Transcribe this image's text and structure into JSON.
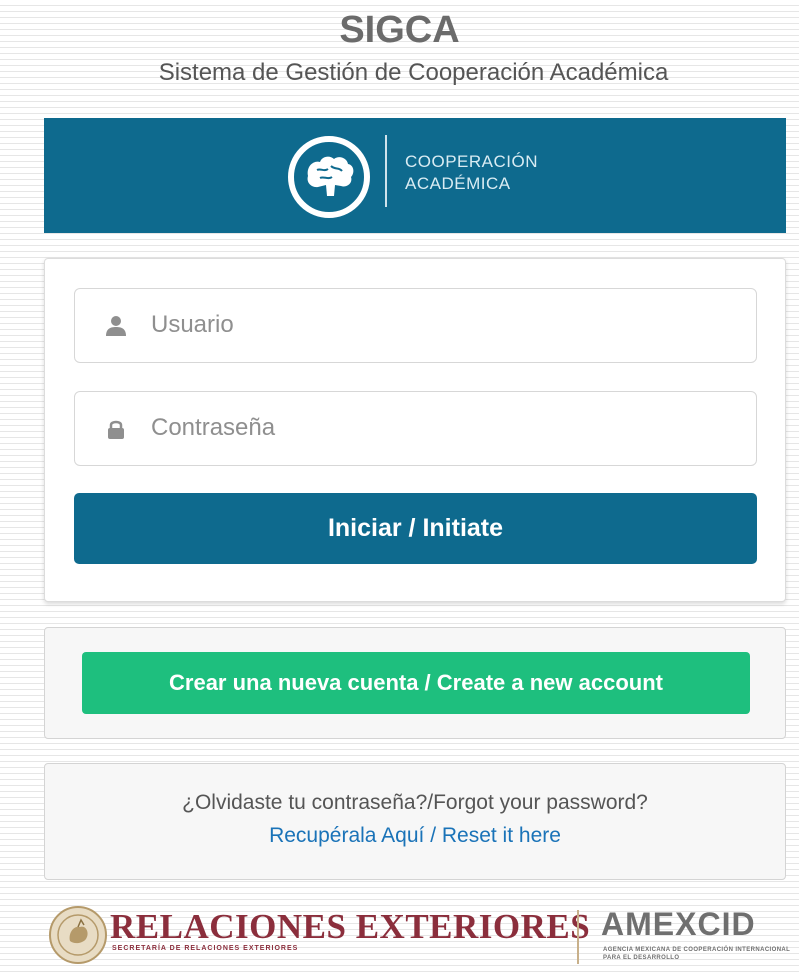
{
  "header": {
    "title": "SIGCA",
    "subtitle": "Sistema de Gestión de Cooperación Académica"
  },
  "banner": {
    "line1": "COOPERACIÓN",
    "line2": "ACADÉMICA",
    "logo_icon": "brain-icon"
  },
  "login": {
    "username_placeholder": "Usuario",
    "password_placeholder": "Contraseña",
    "username_icon": "user-icon",
    "password_icon": "lock-icon",
    "submit_label": "Iniciar / Initiate"
  },
  "signup": {
    "create_label": "Crear una nueva cuenta / Create a new account"
  },
  "recovery": {
    "question": "¿Olvidaste tu contraseña?/Forgot your password?",
    "link_label": "Recupérala Aquí / Reset it here"
  },
  "footer": {
    "sre_name": "RELACIONES EXTERIORES",
    "sre_sub": "SECRETARÍA DE RELACIONES EXTERIORES",
    "amx_name": "AMEXCID",
    "amx_sub": "AGENCIA MEXICANA DE COOPERACIÓN INTERNACIONAL PARA EL DESARROLLO"
  },
  "colors": {
    "primary": "#0e6a8e",
    "success": "#1ebf7e",
    "link": "#1a73b8",
    "sre": "#8b2e3c"
  }
}
